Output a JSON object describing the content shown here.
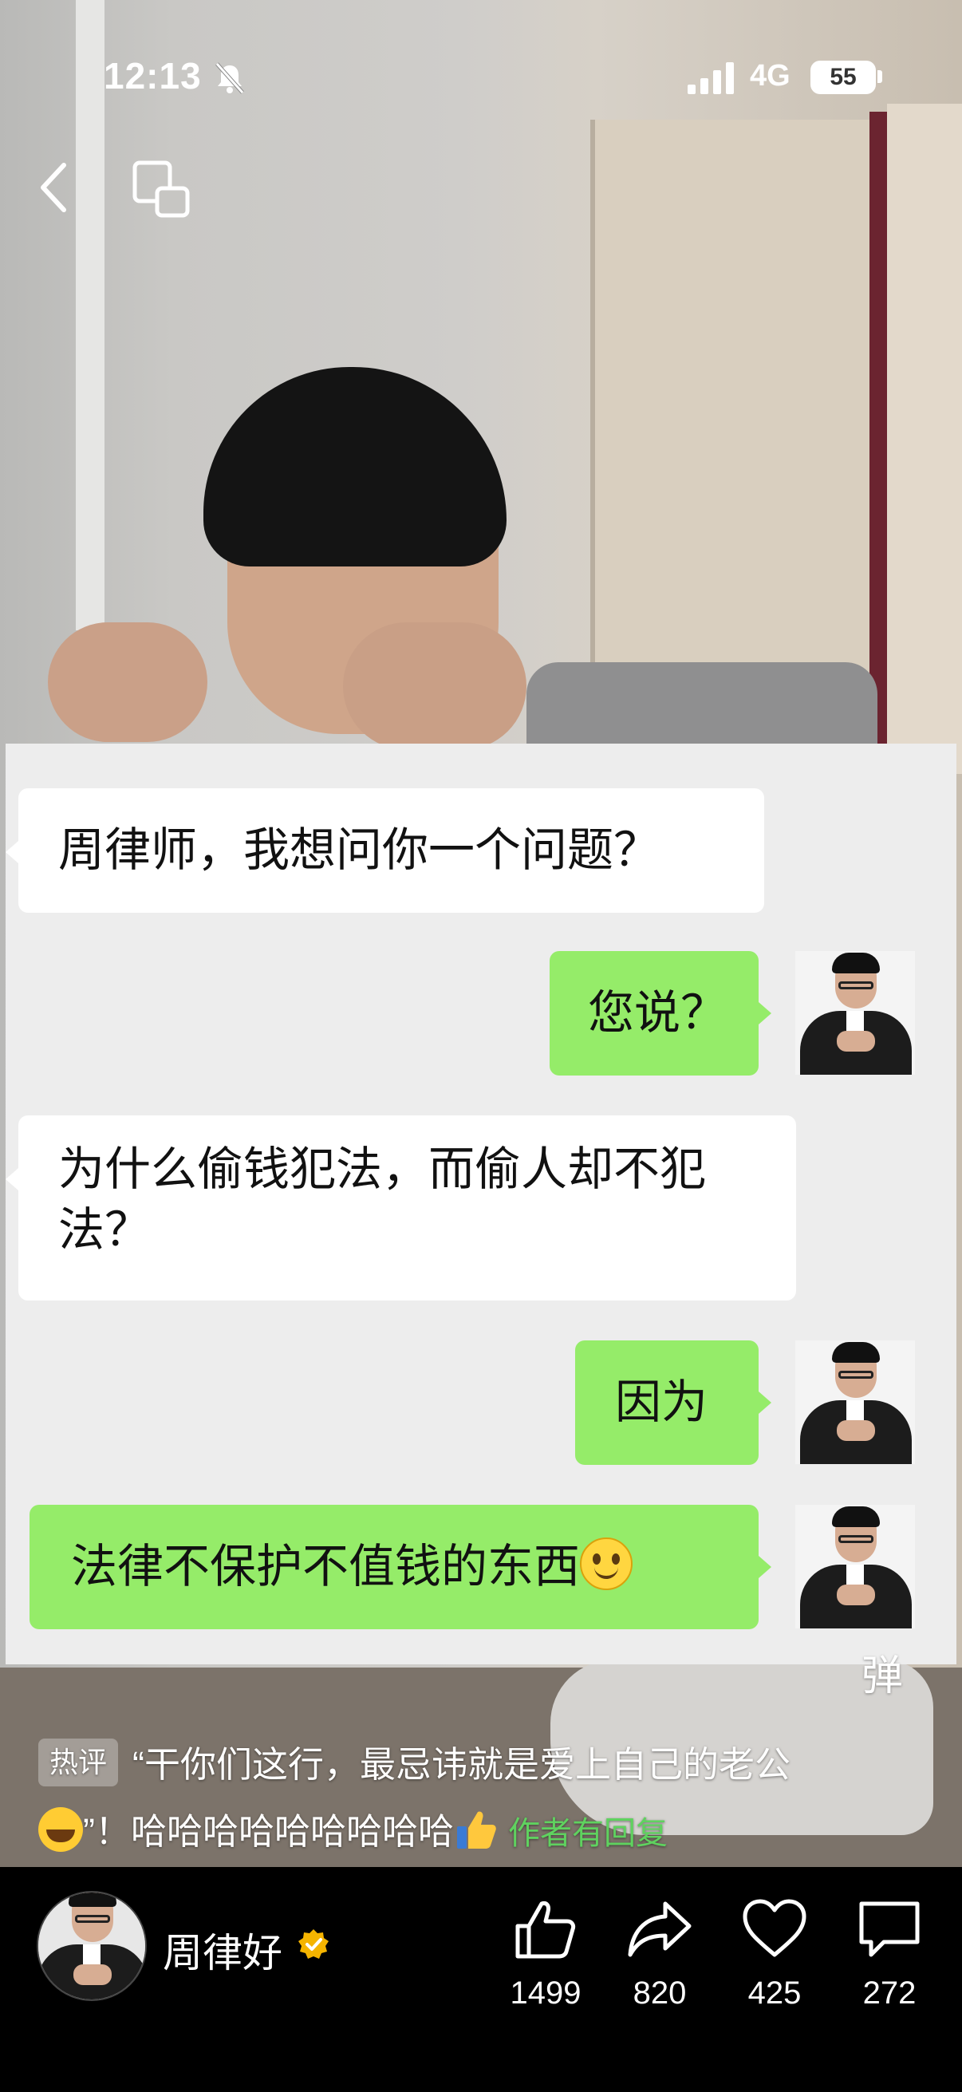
{
  "status_bar": {
    "time": "12:13",
    "network": "4G",
    "battery": "55"
  },
  "chat": {
    "messages": [
      {
        "side": "left",
        "text": "周律师，我想问你一个问题？"
      },
      {
        "side": "right",
        "text": "您说？"
      },
      {
        "side": "left",
        "text": "为什么偷钱犯法，而偷人却不犯法？"
      },
      {
        "side": "right",
        "text": "因为"
      },
      {
        "side": "right",
        "text": "法律不保护不值钱的东西"
      }
    ]
  },
  "danmu_toggle": "弹",
  "hot_comment": {
    "badge": "热评",
    "text_part1": "“干你们这行，最忌讳就是爱上自己的老公",
    "text_part2": "”！哈哈哈哈哈哈哈哈哈",
    "author_replied": "作者有回复"
  },
  "author": {
    "name": "周律好"
  },
  "actions": {
    "like_count": "1499",
    "share_count": "820",
    "favorite_count": "425",
    "comment_count": "272"
  },
  "colors": {
    "bubble_green": "#95ec69",
    "chat_bg": "#ededed",
    "reply_green": "#5fd25f",
    "verified": "#f5b400"
  }
}
